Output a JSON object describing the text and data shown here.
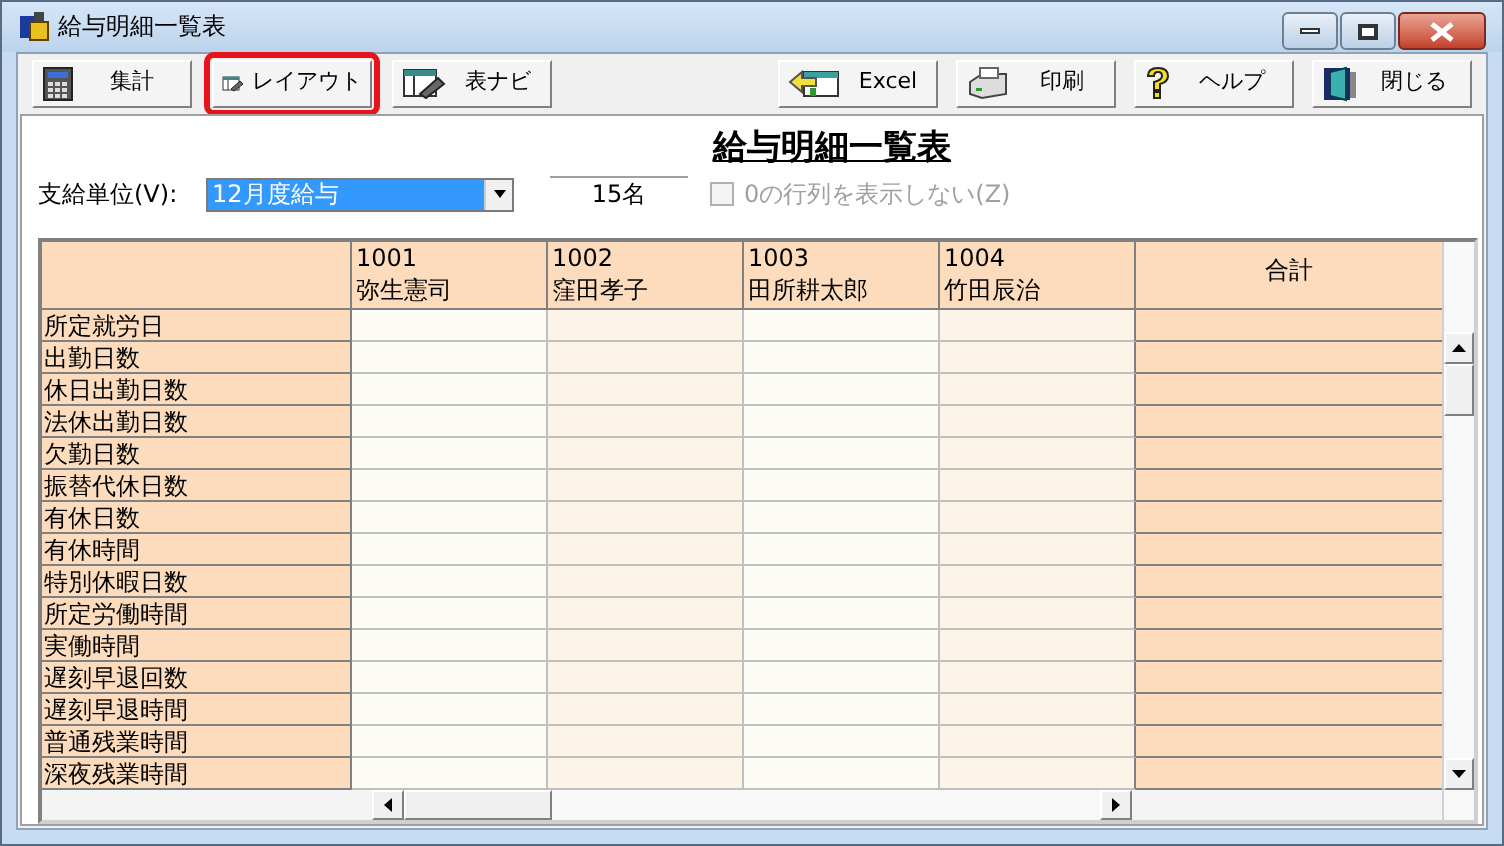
{
  "window": {
    "title": "給与明細一覧表"
  },
  "toolbar": {
    "left": [
      {
        "label": "集計",
        "highlighted": false
      },
      {
        "label": "レイアウト",
        "highlighted": true
      },
      {
        "label": "表ナビ",
        "highlighted": false
      }
    ],
    "right": [
      {
        "label": "Excel",
        "highlighted": false
      },
      {
        "label": "印刷",
        "highlighted": false
      },
      {
        "label": "ヘルプ",
        "highlighted": false
      },
      {
        "label": "閉じる",
        "highlighted": false
      }
    ]
  },
  "report_title": "給与明細一覧表",
  "pay_unit": {
    "label": "支給単位(V):",
    "value": "12月度給与",
    "focused": true
  },
  "count": "15名",
  "hide_zero": {
    "label": "0の行列を表示しない(Z)",
    "checked": false,
    "disabled": true
  },
  "table": {
    "columns": [
      {
        "code": "1001",
        "name": "弥生憲司"
      },
      {
        "code": "1002",
        "name": "窪田孝子"
      },
      {
        "code": "1003",
        "name": "田所耕太郎"
      },
      {
        "code": "1004",
        "name": "竹田辰治"
      }
    ],
    "total_label": "合計",
    "rows": [
      "所定就労日",
      "出勤日数",
      "休日出勤日数",
      "法休出勤日数",
      "欠勤日数",
      "振替代休日数",
      "有休日数",
      "有休時間",
      "特別休暇日数",
      "所定労働時間",
      "実働時間",
      "遅刻早退回数",
      "遅刻早退時間",
      "普通残業時間",
      "深夜残業時間"
    ]
  }
}
